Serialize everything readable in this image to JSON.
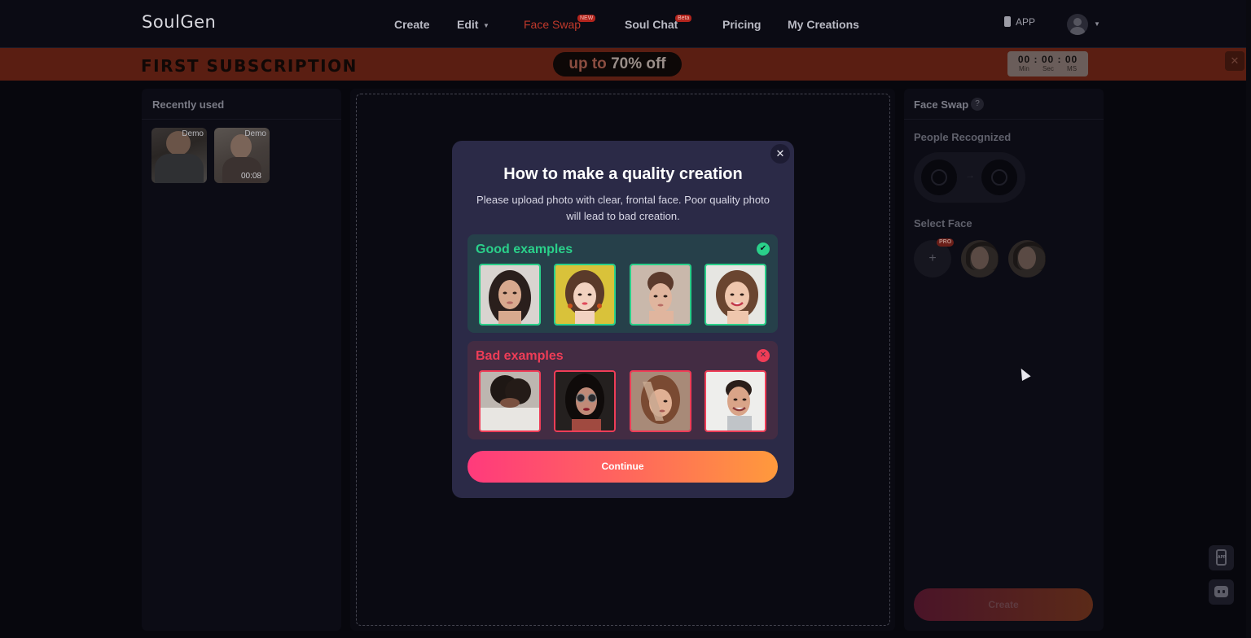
{
  "header": {
    "logo": "SoulGen",
    "nav": [
      {
        "label": "Create"
      },
      {
        "label": "Edit"
      },
      {
        "label": "Face Swap",
        "badge": "NEW"
      },
      {
        "label": "Soul Chat",
        "badge": "Beta"
      },
      {
        "label": "Pricing"
      },
      {
        "label": "My Creations"
      }
    ],
    "app_label": "APP"
  },
  "promo": {
    "title": "FIRST SUBSCRIPTION",
    "offer_prefix": "up to",
    "offer_value": "70% off",
    "timer_digits": "00 : 00 : 00",
    "timer_units": "Min Sec MS"
  },
  "left_panel": {
    "title": "Recently used",
    "items": [
      {
        "tag": "Demo"
      },
      {
        "tag": "Demo",
        "duration": "00:08"
      }
    ]
  },
  "right_panel": {
    "title": "Face Swap",
    "help": "?",
    "people_label": "People Recognized",
    "select_label": "Select Face",
    "add_symbol": "+",
    "pro_badge": "PRO",
    "create_label": "Create"
  },
  "modal": {
    "title": "How to make a quality creation",
    "description": "Please upload photo with clear, frontal face. Poor quality photo will lead to bad creation.",
    "good_title": "Good examples",
    "bad_title": "Bad examples",
    "continue_label": "Continue",
    "close_symbol": "✕",
    "good_icon": "✔",
    "bad_icon": "✕"
  },
  "floating": {
    "app_mini": "APP"
  },
  "colors": {
    "accent_active": "#c0392b",
    "good": "#2ad08a",
    "bad": "#ef3d57",
    "cta_start": "#ff3a7c",
    "cta_end": "#ff9a3c",
    "modal_bg": "#2b2a47"
  },
  "icons": [
    "close-icon",
    "check-icon",
    "error-icon",
    "help-icon",
    "phone-icon",
    "chat-bot-icon",
    "user-avatar-icon",
    "chevron-down-icon",
    "plus-icon",
    "arrow-right-icon"
  ]
}
